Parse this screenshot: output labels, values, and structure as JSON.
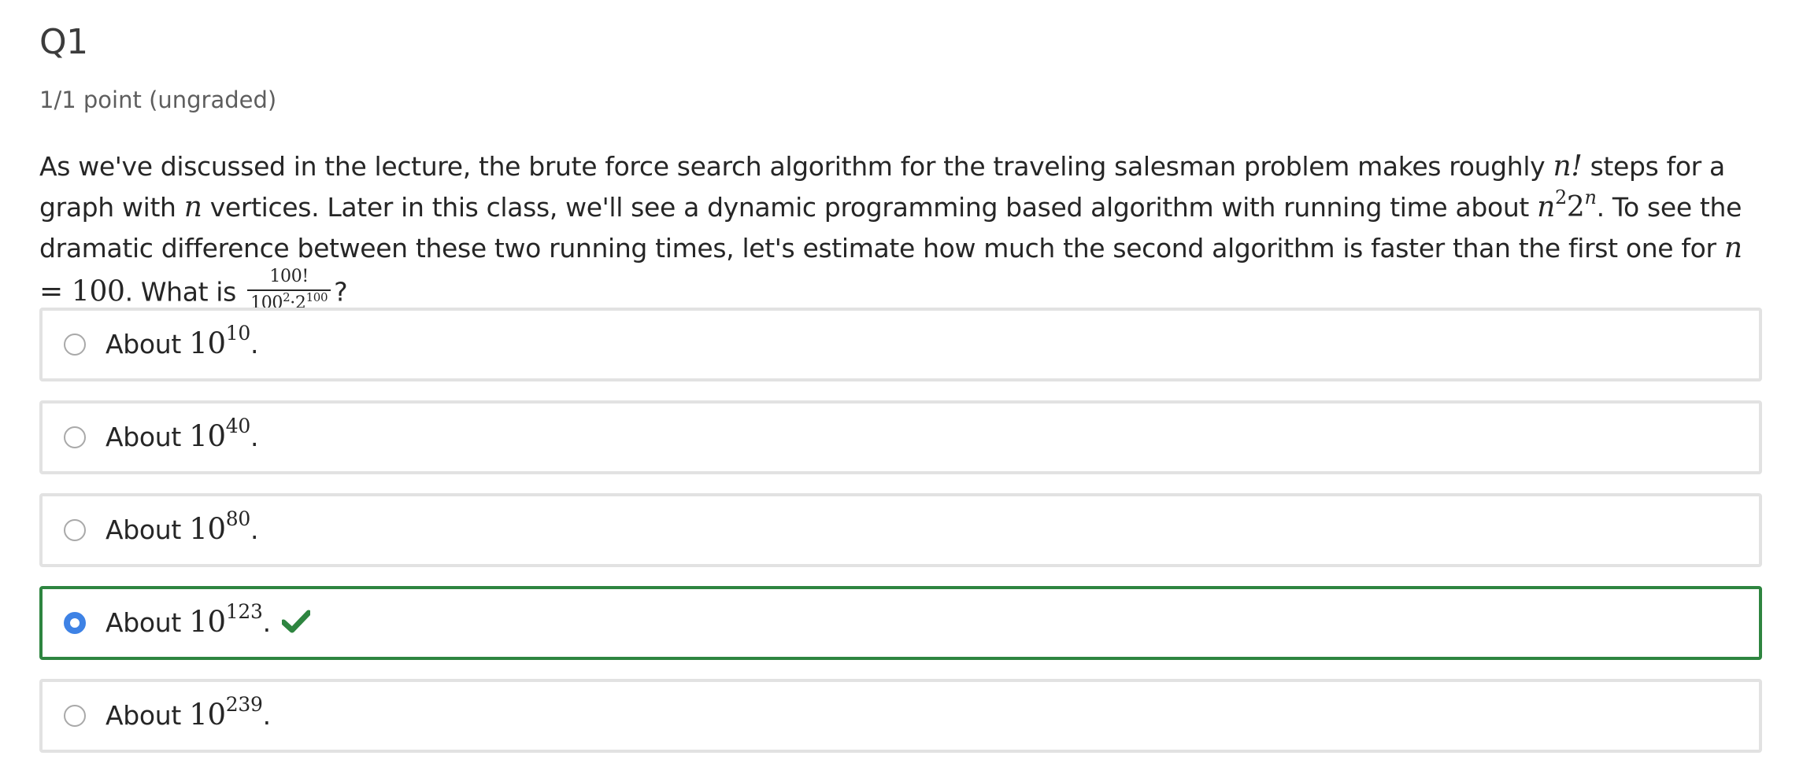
{
  "question": {
    "title": "Q1",
    "points": "1/1 point (ungraded)",
    "stem": {
      "part1": "As we've discussed in the lecture, the brute force search algorithm for the traveling salesman problem makes roughly ",
      "nfact": "n!",
      "part2": " steps for a graph with ",
      "n1": "n",
      "part3": " vertices. Later in this class, we'll see a dynamic programming based algorithm with running time about ",
      "n2": "n",
      "exp2": "2",
      "two": "2",
      "expn": "n",
      "part4": ". To see the dramatic difference between these two running times, let's estimate how much the second algorithm is faster than the first one for ",
      "n3": "n",
      "eq": " = 100",
      "part5": ". What is ",
      "frac_num": "100!",
      "frac_den_a": "100",
      "frac_den_a_exp": "2",
      "frac_den_dot": "·2",
      "frac_den_b_exp": "100",
      "part6": "?"
    }
  },
  "options": [
    {
      "prefix": "About ",
      "base": "10",
      "exp": "10",
      "suffix": ".",
      "selected": false,
      "correct": false
    },
    {
      "prefix": "About ",
      "base": "10",
      "exp": "40",
      "suffix": ".",
      "selected": false,
      "correct": false
    },
    {
      "prefix": "About ",
      "base": "10",
      "exp": "80",
      "suffix": ".",
      "selected": false,
      "correct": false
    },
    {
      "prefix": "About ",
      "base": "10",
      "exp": "123",
      "suffix": ".",
      "selected": true,
      "correct": true
    },
    {
      "prefix": "About ",
      "base": "10",
      "exp": "239",
      "suffix": ".",
      "selected": false,
      "correct": false
    }
  ],
  "colors": {
    "correct_border": "#2e8540",
    "radio_selected": "#3e82e5",
    "checkmark": "#2e8540"
  },
  "icons": {
    "checkmark": "checkmark-icon"
  }
}
